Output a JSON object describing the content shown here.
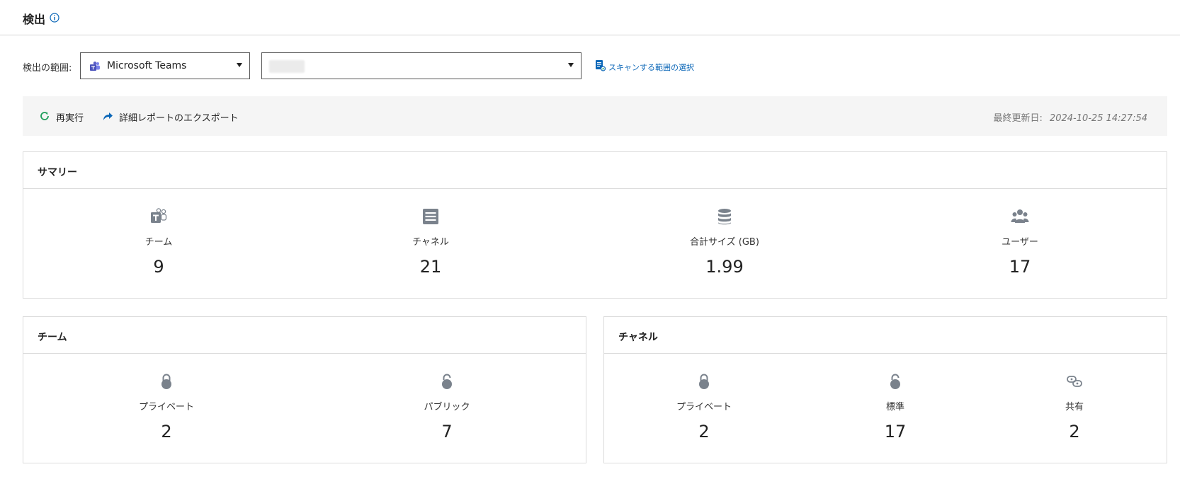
{
  "header": {
    "title": "検出"
  },
  "scope": {
    "label": "検出の範囲:",
    "service_select": {
      "value": "Microsoft Teams"
    },
    "scan_link": "スキャンする範囲の選択"
  },
  "toolbar": {
    "rerun_label": "再実行",
    "export_label": "詳細レポートのエクスポート",
    "updated_label": "最終更新日:",
    "updated_value": "2024-10-25 14:27:54"
  },
  "summary": {
    "title": "サマリー",
    "items": [
      {
        "label": "チーム",
        "value": "9",
        "icon": "teams-icon"
      },
      {
        "label": "チャネル",
        "value": "21",
        "icon": "channel-icon"
      },
      {
        "label": "合計サイズ (GB)",
        "value": "1.99",
        "icon": "database-icon"
      },
      {
        "label": "ユーザー",
        "value": "17",
        "icon": "users-icon"
      }
    ]
  },
  "teams_panel": {
    "title": "チーム",
    "items": [
      {
        "label": "プライベート",
        "value": "2",
        "icon": "lock-icon"
      },
      {
        "label": "パブリック",
        "value": "7",
        "icon": "unlock-icon"
      }
    ]
  },
  "channels_panel": {
    "title": "チャネル",
    "items": [
      {
        "label": "プライベート",
        "value": "2",
        "icon": "lock-icon"
      },
      {
        "label": "標準",
        "value": "17",
        "icon": "unlock-icon"
      },
      {
        "label": "共有",
        "value": "2",
        "icon": "link-icon"
      }
    ]
  },
  "colors": {
    "link": "#0a66b7",
    "icon": "#7a828c",
    "rerun": "#1e9e5a",
    "teams": "#5b5fc7",
    "toolbar_bg": "#f5f5f5"
  }
}
